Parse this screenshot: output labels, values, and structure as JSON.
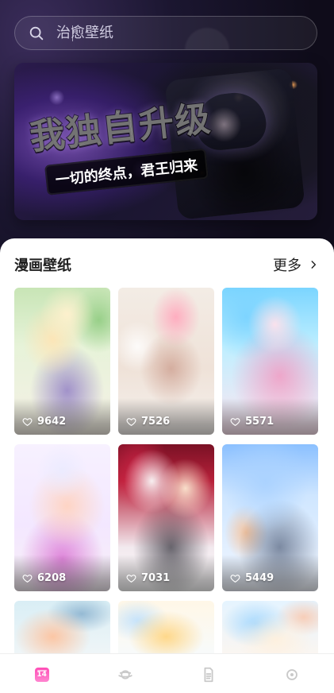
{
  "search": {
    "placeholder": "治愈壁纸"
  },
  "banner": {
    "title": "我独自升级",
    "subtitle": "一切的终点，君王归来"
  },
  "section": {
    "title": "漫画壁纸",
    "more_label": "更多"
  },
  "wallpapers": [
    {
      "likes": "9642",
      "art": "art-1"
    },
    {
      "likes": "7526",
      "art": "art-2"
    },
    {
      "likes": "5571",
      "art": "art-3"
    },
    {
      "likes": "6208",
      "art": "art-4"
    },
    {
      "likes": "7031",
      "art": "art-5"
    },
    {
      "likes": "5449",
      "art": "art-6"
    },
    {
      "likes": "",
      "art": "art-7"
    },
    {
      "likes": "",
      "art": "art-8"
    },
    {
      "likes": "",
      "art": "art-9"
    }
  ],
  "bottom_nav": {
    "active_badge": "14",
    "items": [
      {
        "icon": "calendar-icon"
      },
      {
        "icon": "planet-icon"
      },
      {
        "icon": "document-icon"
      },
      {
        "icon": "settings-icon"
      }
    ]
  },
  "colors": {
    "accent": "#ff4db6",
    "sheet_bg": "#ffffff",
    "nav_icon": "#c9c9c9"
  }
}
